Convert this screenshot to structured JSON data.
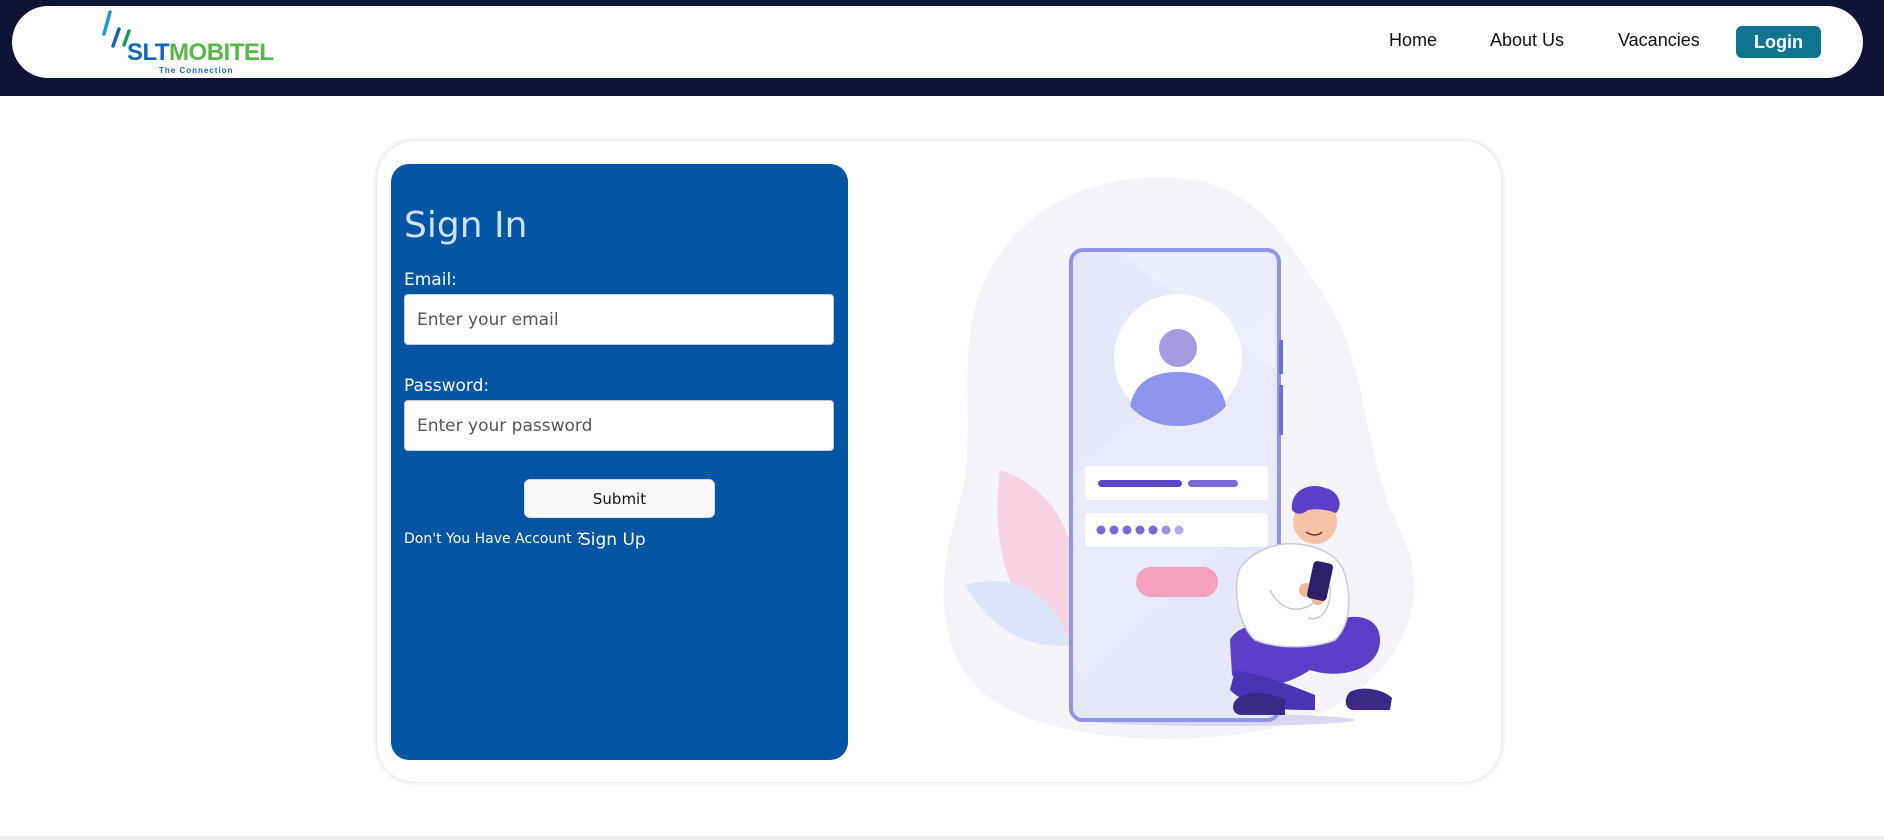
{
  "header": {
    "logo": {
      "brand_part1": "SLT",
      "brand_part2": "MOBITEL",
      "tagline": "The Connection"
    },
    "nav": {
      "home": "Home",
      "about": "About Us",
      "vacancies": "Vacancies",
      "login": "Login"
    }
  },
  "signin": {
    "title": "Sign In",
    "email_label": "Email:",
    "email_placeholder": "Enter your email",
    "password_label": "Password:",
    "password_placeholder": "Enter your password",
    "submit_label": "Submit",
    "no_account_text": "Don't You Have Account ?",
    "signup_label": "Sign Up"
  },
  "colors": {
    "topbar": "#0f1437",
    "panel": "#0255a2",
    "login_button": "#0e7490",
    "brand_blue": "#1466b8",
    "brand_green": "#56b947"
  },
  "illustration": {
    "icon": "person-with-phone-login-illustration"
  }
}
